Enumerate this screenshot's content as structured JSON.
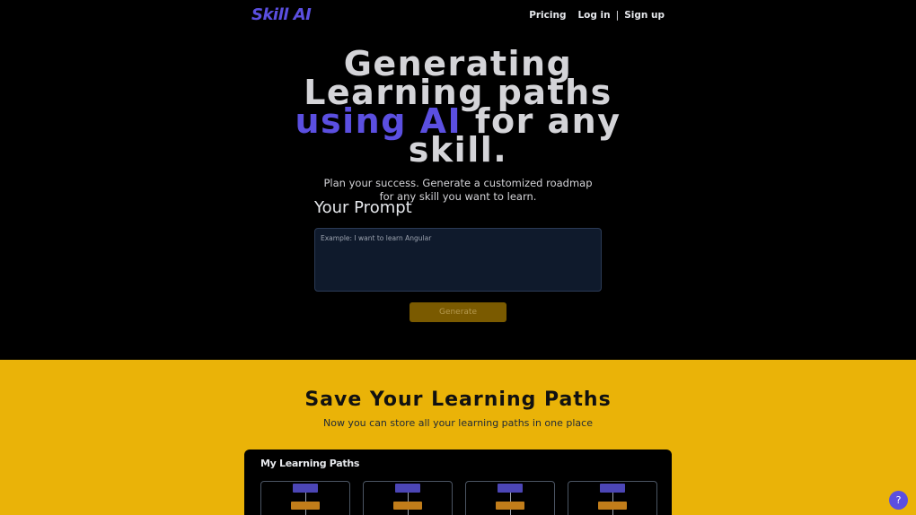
{
  "nav": {
    "logo": "Skill AI",
    "pricing": "Pricing",
    "login": "Log in",
    "separator": "|",
    "signup": "Sign up"
  },
  "hero": {
    "title_part1": "Generating Learning paths ",
    "title_accent": "using AI",
    "title_part2": " for any skill.",
    "subtitle": "Plan your success. Generate a customized roadmap for any skill you want to learn."
  },
  "prompt": {
    "label": "Your Prompt",
    "placeholder": "Example: I want to learn Angular",
    "value": "",
    "button_label": "Generate"
  },
  "save": {
    "title": "Save Your Learning Paths",
    "subtitle": "Now you can store all your learning paths in one place",
    "panel_title": "My Learning Paths"
  },
  "help": {
    "label": "?"
  },
  "colors": {
    "accent": "#5b4fe0",
    "section_bg": "#eab308",
    "button_bg": "#7a5a00"
  }
}
